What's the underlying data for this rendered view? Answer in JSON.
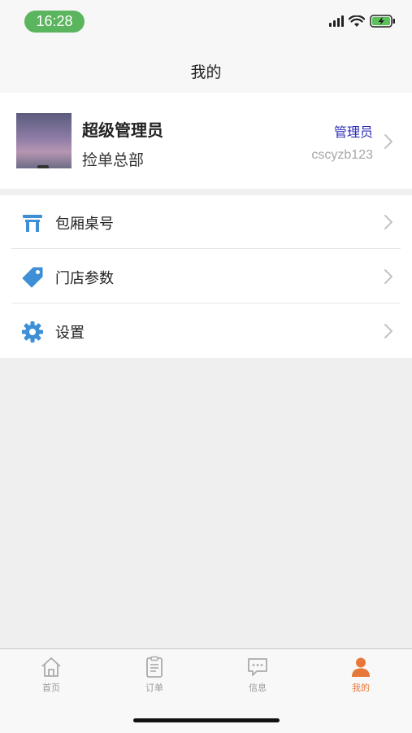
{
  "status_bar": {
    "time": "16:28"
  },
  "header": {
    "title": "我的"
  },
  "profile": {
    "name": "超级管理员",
    "org": "捡单总部",
    "role": "管理员",
    "account": "cscyzb123"
  },
  "menu": [
    {
      "label": "包厢桌号",
      "icon": "table-icon"
    },
    {
      "label": "门店参数",
      "icon": "tag-icon"
    },
    {
      "label": "设置",
      "icon": "gear-icon"
    }
  ],
  "tabs": [
    {
      "label": "首页",
      "icon": "home-icon",
      "active": false
    },
    {
      "label": "订单",
      "icon": "clipboard-icon",
      "active": false
    },
    {
      "label": "信息",
      "icon": "message-icon",
      "active": false
    },
    {
      "label": "我的",
      "icon": "user-icon",
      "active": true
    }
  ],
  "colors": {
    "accent": "#e8773a",
    "icon_blue": "#3f8fd6",
    "role_text": "#2b2bb8",
    "status_pill": "#5bb55e"
  }
}
